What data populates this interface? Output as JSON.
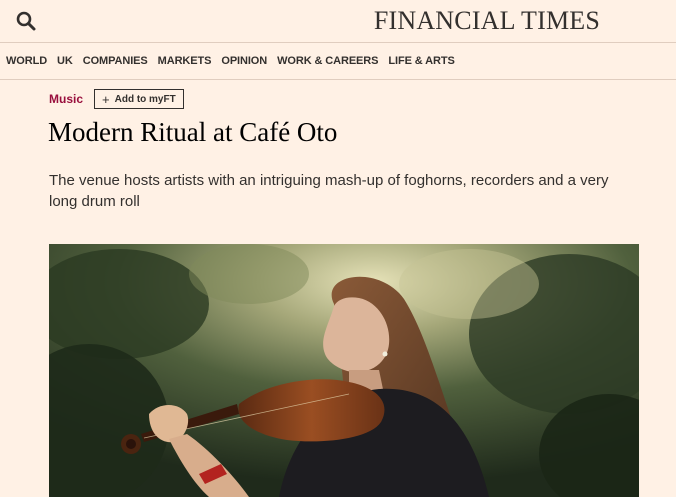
{
  "header": {
    "masthead": "FINANCIAL TIMES",
    "search_icon": "search-icon"
  },
  "nav": {
    "items": [
      "WORLD",
      "UK",
      "COMPANIES",
      "MARKETS",
      "OPINION",
      "WORK & CAREERS",
      "LIFE & ARTS"
    ]
  },
  "article": {
    "topic": "Music",
    "myft_label": "Add to myFT",
    "myft_icon": "plus-icon",
    "headline": "Modern Ritual at Café Oto",
    "standfirst": "The venue hosts artists with an intriguing mash-up of foghorns, recorders and a very long drum roll"
  },
  "colors": {
    "background": "#fff1e5",
    "text": "#33302e",
    "topic": "#990f3d",
    "divider": "#e0cdbf"
  }
}
